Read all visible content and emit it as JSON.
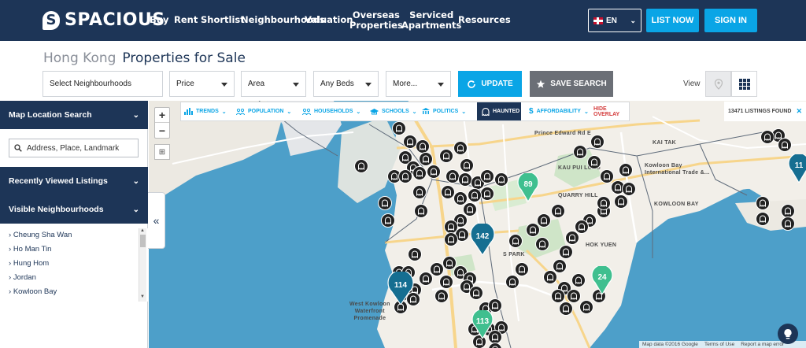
{
  "brand": {
    "name": "SPACIOUS",
    "badge": "S"
  },
  "nav": {
    "items": [
      {
        "label": "Buy"
      },
      {
        "label": "Rent"
      },
      {
        "label": "Shortlist"
      },
      {
        "label": "Neighbourhoods"
      },
      {
        "label": "Valuation"
      },
      {
        "label": "Overseas\nProperties"
      },
      {
        "label": "Serviced\nApartments"
      },
      {
        "label": "Resources"
      }
    ],
    "language": "EN",
    "list_now": "LIST NOW",
    "sign_in": "SIGN IN"
  },
  "page": {
    "city": "Hong Kong",
    "title": "Properties for Sale"
  },
  "filters": {
    "neighbourhoods": "Select Neighbourhoods",
    "price": "Price",
    "area": "Area",
    "beds": "Any Beds",
    "more": "More...",
    "update": "UPDATE",
    "save_search": "SAVE SEARCH",
    "view_label": "View"
  },
  "sidebar": {
    "map_search_title": "Map Location Search",
    "search_placeholder": "Address, Place, Landmark",
    "recent_title": "Recently Viewed Listings",
    "visible_title": "Visible Neighbourhoods",
    "neighbourhoods": [
      "Cheung Sha Wan",
      "Ho Man Tin",
      "Hung Hom",
      "Jordan",
      "Kowloon Bay"
    ]
  },
  "layers": {
    "items": [
      {
        "label": "TRENDS",
        "icon": "bar-chart-icon"
      },
      {
        "label": "POPULATION",
        "icon": "people-icon"
      },
      {
        "label": "HOUSEHOLDS",
        "icon": "people-icon"
      },
      {
        "label": "SCHOOLS",
        "icon": "graduation-cap-icon"
      },
      {
        "label": "POLITICS",
        "icon": "building-icon"
      },
      {
        "label": "HAUNTED",
        "icon": "ghost-icon"
      },
      {
        "label": "AFFORDABILITY",
        "icon": "dollar-icon"
      },
      {
        "label": "HIDE OVERLAY",
        "icon": ""
      }
    ],
    "listings_found": "13471 LISTINGS FOUND"
  },
  "map": {
    "labels": [
      {
        "text": "Prince Edward Rd E"
      },
      {
        "text": "KAI TAK"
      },
      {
        "text": "KAU PUI LUNG"
      },
      {
        "text": "QUARRY HILL"
      },
      {
        "text": "Kowloon Bay\nInternational Trade &..."
      },
      {
        "text": "KOWLOON BAY"
      },
      {
        "text": "HOK YUEN"
      },
      {
        "text": "West Kowloon\nWaterfront\nPromenade"
      },
      {
        "text": "S PARK"
      }
    ],
    "clusters": [
      "89",
      "142",
      "114",
      "24",
      "113",
      "11"
    ],
    "attribution": [
      "Map data ©2016 Google",
      "Terms of Use",
      "Report a map error"
    ]
  },
  "colors": {
    "navy": "#1d3557",
    "accent": "#0aa5e6",
    "teal": "#3fbf8f",
    "water": "#4d9fc9",
    "land": "#f2efe9"
  }
}
